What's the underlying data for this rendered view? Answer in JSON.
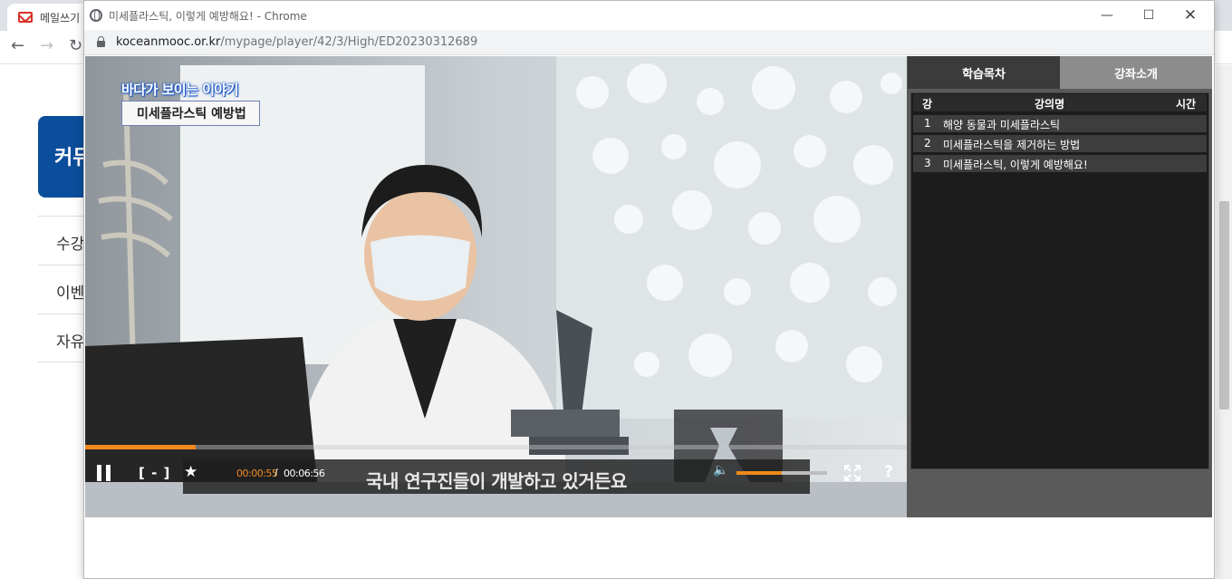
{
  "background_browser": {
    "tab_title": "메일쓰기",
    "community_label": "커뮤",
    "menu_items": [
      "수강",
      "이벤",
      "자유"
    ]
  },
  "popup": {
    "window_title": "미세플라스틱, 이렇게 예방해요! - Chrome",
    "address_host": "koceanmooc.or.kr",
    "address_path": "/mypage/player/42/3/High/ED20230312689"
  },
  "video": {
    "caption_top": "바다가 보이는 이야기",
    "caption_sub": "미세플라스틱 예방법",
    "subtitle": "국내 연구진들이 개발하고 있거든요",
    "progress_fraction": 0.135,
    "current_time": "00:00:55",
    "time_separator": "/",
    "total_time": "00:06:56",
    "volume_fraction": 0.5,
    "bracket_label": "[ - ]",
    "help_label": "?",
    "accent_color": "#f08a1c"
  },
  "side_panel": {
    "tabs": [
      {
        "label": "학습목차",
        "active": true
      },
      {
        "label": "강좌소개",
        "active": false
      }
    ],
    "columns": {
      "num": "강",
      "name": "강의명",
      "time": "시간"
    },
    "lessons": [
      {
        "num": "1",
        "name": "해양 동물과 미세플라스틱"
      },
      {
        "num": "2",
        "name": "미세플라스틱을 제거하는 방법"
      },
      {
        "num": "3",
        "name": "미세플라스틱, 이렇게 예방해요!"
      }
    ]
  }
}
